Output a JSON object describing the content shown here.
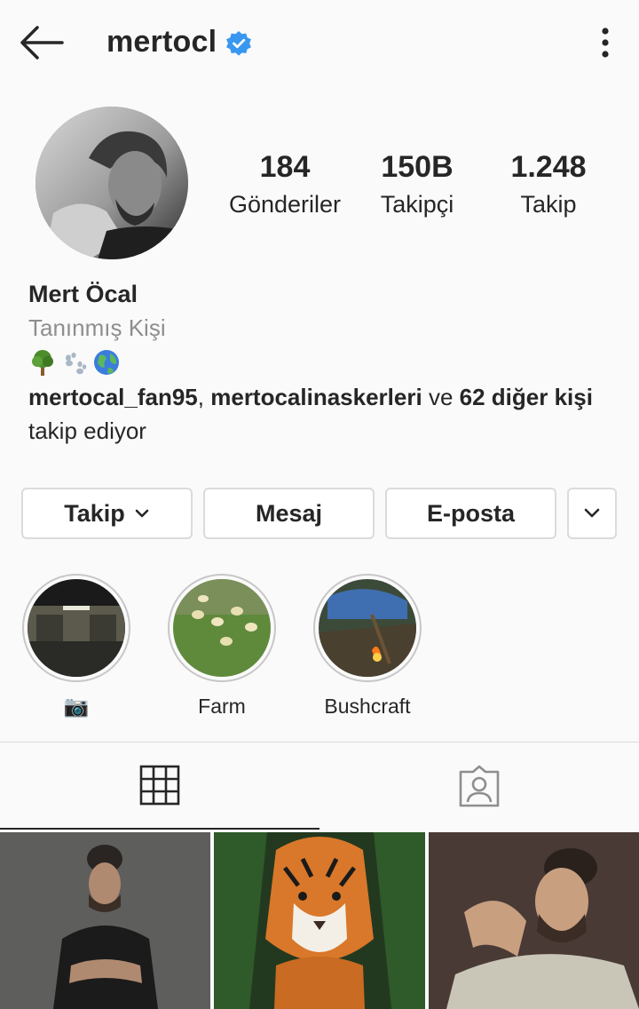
{
  "header": {
    "username": "mertocl",
    "verified": true
  },
  "profile": {
    "full_name": "Mert Öcal",
    "category": "Tanınmış Kişi",
    "bio_emojis": [
      "tree",
      "paw-prints",
      "globe"
    ],
    "followed_by": {
      "user1": "mertocal_fan95",
      "separator": ",",
      "user2": "mertocalinaskerleri",
      "and_word": "ve",
      "others": "62 diğer kişi",
      "suffix": "takip ediyor"
    }
  },
  "stats": {
    "posts": {
      "value": "184",
      "label": "Gönderiler"
    },
    "followers": {
      "value": "150B",
      "label": "Takipçi"
    },
    "following": {
      "value": "1.248",
      "label": "Takip"
    }
  },
  "actions": {
    "follow_label": "Takip",
    "message_label": "Mesaj",
    "email_label": "E-posta"
  },
  "highlights": [
    {
      "label": "📷",
      "icon": "camera"
    },
    {
      "label": "Farm"
    },
    {
      "label": "Bushcraft"
    }
  ],
  "tabs": [
    {
      "icon": "grid-icon",
      "active": true
    },
    {
      "icon": "tagged-icon",
      "active": false
    }
  ],
  "colors": {
    "verified_blue": "#3897f0",
    "text": "#262626",
    "secondary_text": "#8e8e8e",
    "border": "#dbdbdb"
  }
}
